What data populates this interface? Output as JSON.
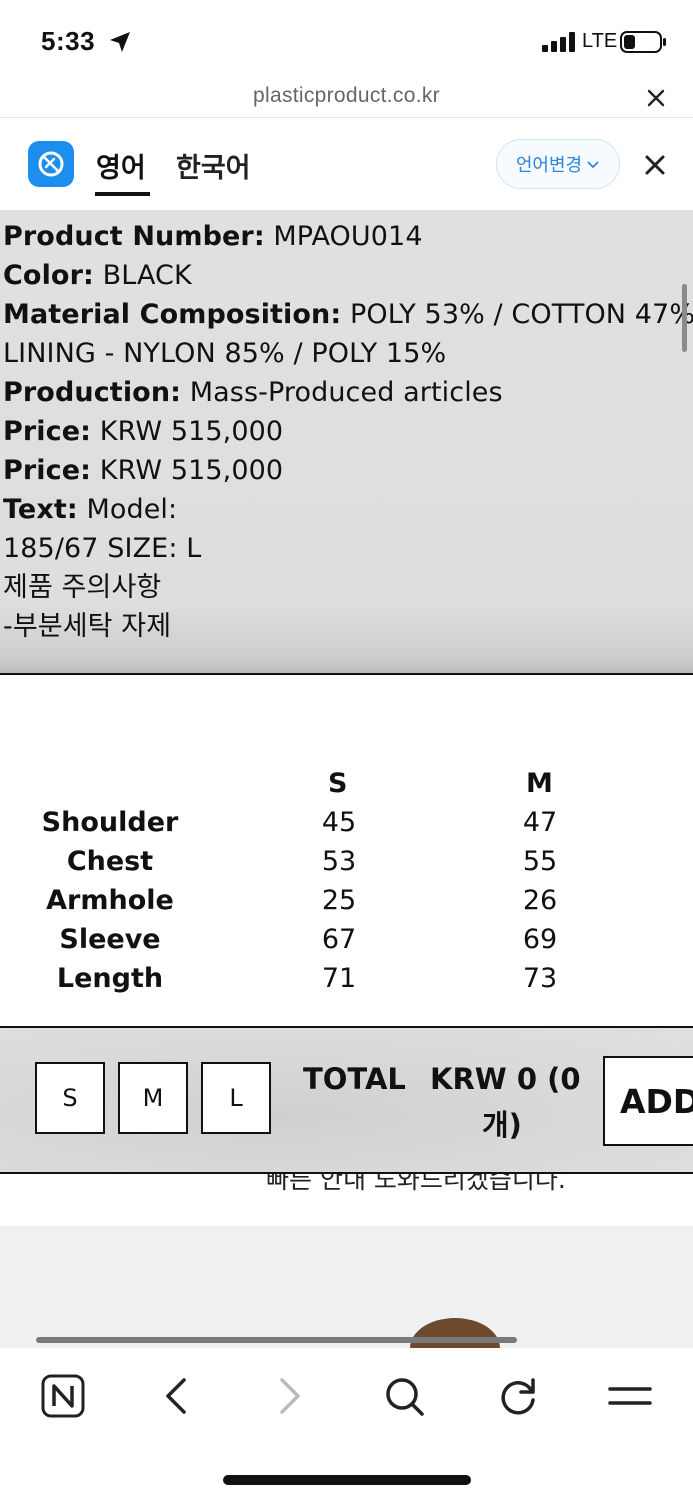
{
  "status_bar": {
    "time": "5:33",
    "network": "LTE",
    "icons": [
      "location-arrow-icon",
      "signal-bars-icon",
      "battery-icon"
    ]
  },
  "browser": {
    "url": "plasticproduct.co.kr"
  },
  "translate_bar": {
    "tab_source": "영어",
    "tab_target": "한국어",
    "change_language": "언어변경",
    "accent_color": "#1b8ef0"
  },
  "product_info": {
    "lines": [
      {
        "label": "Product Number:",
        "value": "MPAOU014"
      },
      {
        "label": "Color:",
        "value": "BLACK"
      },
      {
        "label": "Material Composition:",
        "value": "POLY 53% / COTTON 47%"
      },
      {
        "label": "",
        "value": "LINING - NYLON 85% / POLY 15%"
      },
      {
        "label": "Production:",
        "value": "Mass-Produced articles"
      },
      {
        "label": "Price:",
        "value": "KRW 515,000"
      },
      {
        "label": "Price:",
        "value": "KRW 515,000"
      },
      {
        "label": "Text:",
        "value": "Model:"
      },
      {
        "label": "",
        "value": "185/67 SIZE: L"
      },
      {
        "label": "",
        "value": "제품 주의사항"
      },
      {
        "label": "",
        "value": "-부분세탁 자제"
      }
    ]
  },
  "size_table": {
    "columns": [
      "S",
      "M"
    ],
    "rows": [
      {
        "label": "Shoulder",
        "values": [
          "45",
          "47"
        ]
      },
      {
        "label": "Chest",
        "values": [
          "53",
          "55"
        ]
      },
      {
        "label": "Armhole",
        "values": [
          "25",
          "26"
        ]
      },
      {
        "label": "Sleeve",
        "values": [
          "67",
          "69"
        ]
      },
      {
        "label": "Length",
        "values": [
          "71",
          "73"
        ]
      }
    ]
  },
  "purchase_bar": {
    "size_options": [
      "S",
      "M",
      "L"
    ],
    "total_label": "TOTAL",
    "total_amount": "KRW 0 (0",
    "total_amount_cont": "개)",
    "add_label": "ADD"
  },
  "page_text": {
    "partial_line": "빠른 안내 도와드리겠습니다."
  },
  "toolbar": {
    "icons": [
      "naver-icon",
      "back-icon",
      "forward-icon",
      "search-icon",
      "reload-icon",
      "menu-icon"
    ]
  }
}
